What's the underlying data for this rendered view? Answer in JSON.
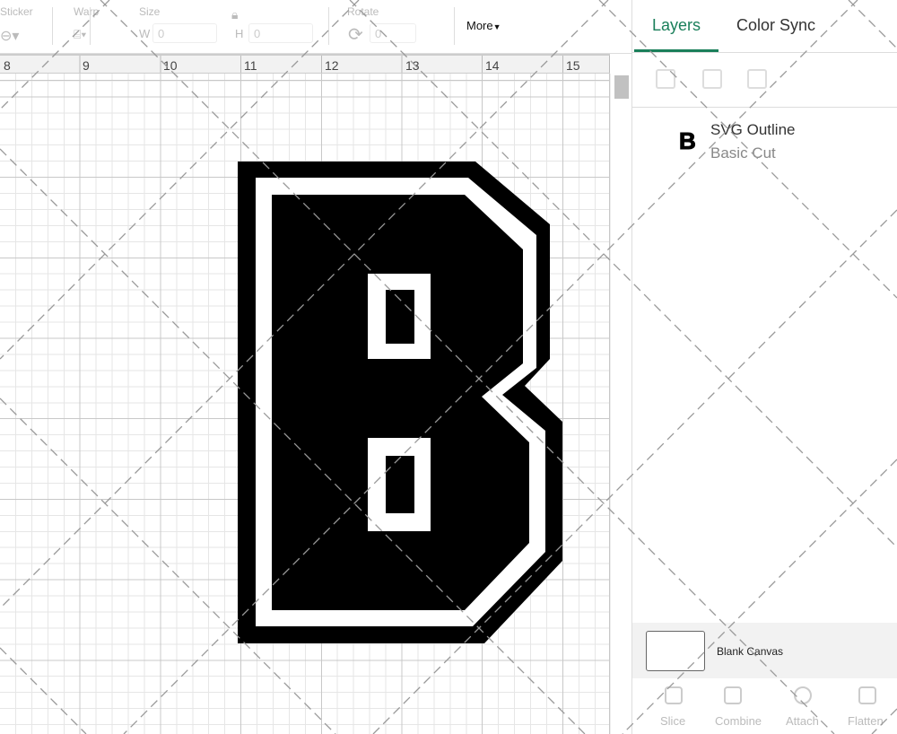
{
  "toolbar": {
    "sticker": "Sticker",
    "warp": "Warp",
    "size": "Size",
    "w_label": "W",
    "w_value": "0",
    "h_label": "H",
    "h_value": "0",
    "rotate": "Rotate",
    "rotate_value": "0",
    "more": "More"
  },
  "ruler": {
    "ticks": [
      "8",
      "9",
      "10",
      "11",
      "12",
      "13",
      "14",
      "15"
    ]
  },
  "panel": {
    "tabs": [
      "Layers",
      "Color Sync"
    ],
    "layer": {
      "name": "SVG Outline",
      "type": "Basic Cut"
    },
    "blank_canvas": "Blank Canvas",
    "actions": [
      "Slice",
      "Combine",
      "Attach",
      "Flatten"
    ]
  }
}
